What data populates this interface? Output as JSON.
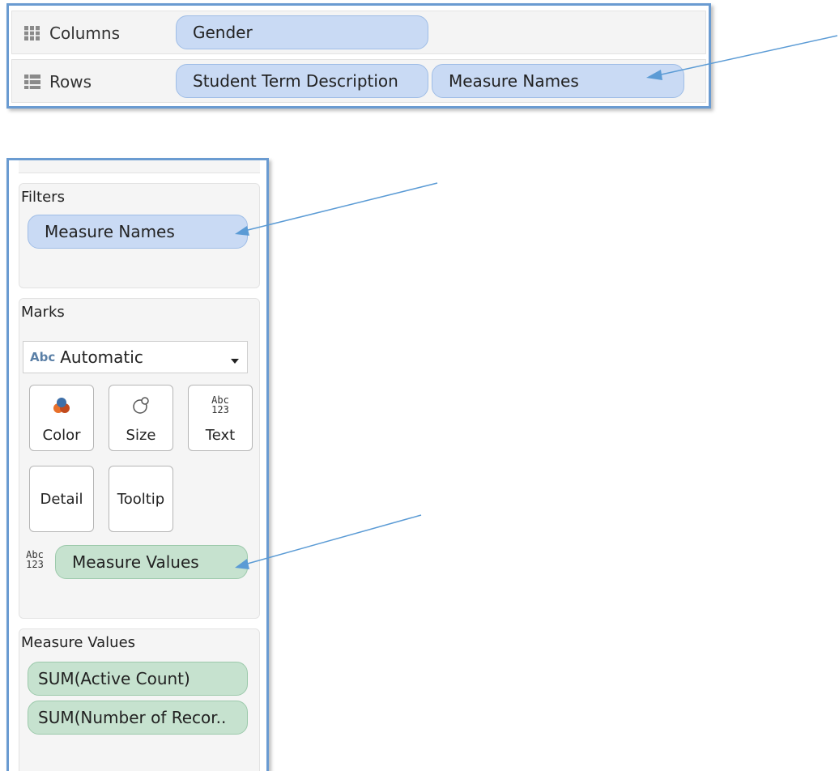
{
  "shelves": {
    "columns": {
      "label": "Columns",
      "pills": [
        "Gender"
      ]
    },
    "rows": {
      "label": "Rows",
      "pills": [
        "Student Term Description",
        "Measure Names"
      ]
    }
  },
  "cards": {
    "filters": {
      "title": "Filters",
      "pills": [
        "Measure Names"
      ]
    },
    "marks": {
      "title": "Marks",
      "mark_type": {
        "icon_text": "Abc",
        "value": "Automatic"
      },
      "buttons": {
        "color": "Color",
        "size": "Size",
        "text": "Text",
        "detail": "Detail",
        "tooltip": "Tooltip"
      },
      "text_icon": {
        "line1": "Abc",
        "line2": "123"
      },
      "field_pill": "Measure Values"
    },
    "measure_values": {
      "title": "Measure Values",
      "pills": [
        "SUM(Active Count)",
        "SUM(Number of Recor.."
      ]
    }
  },
  "colors": {
    "panel_border": "#6a9bd1",
    "dimension_pill": "#c9daf4",
    "measure_pill": "#c6e2cf",
    "annotation_arrow": "#5b9bd5"
  }
}
